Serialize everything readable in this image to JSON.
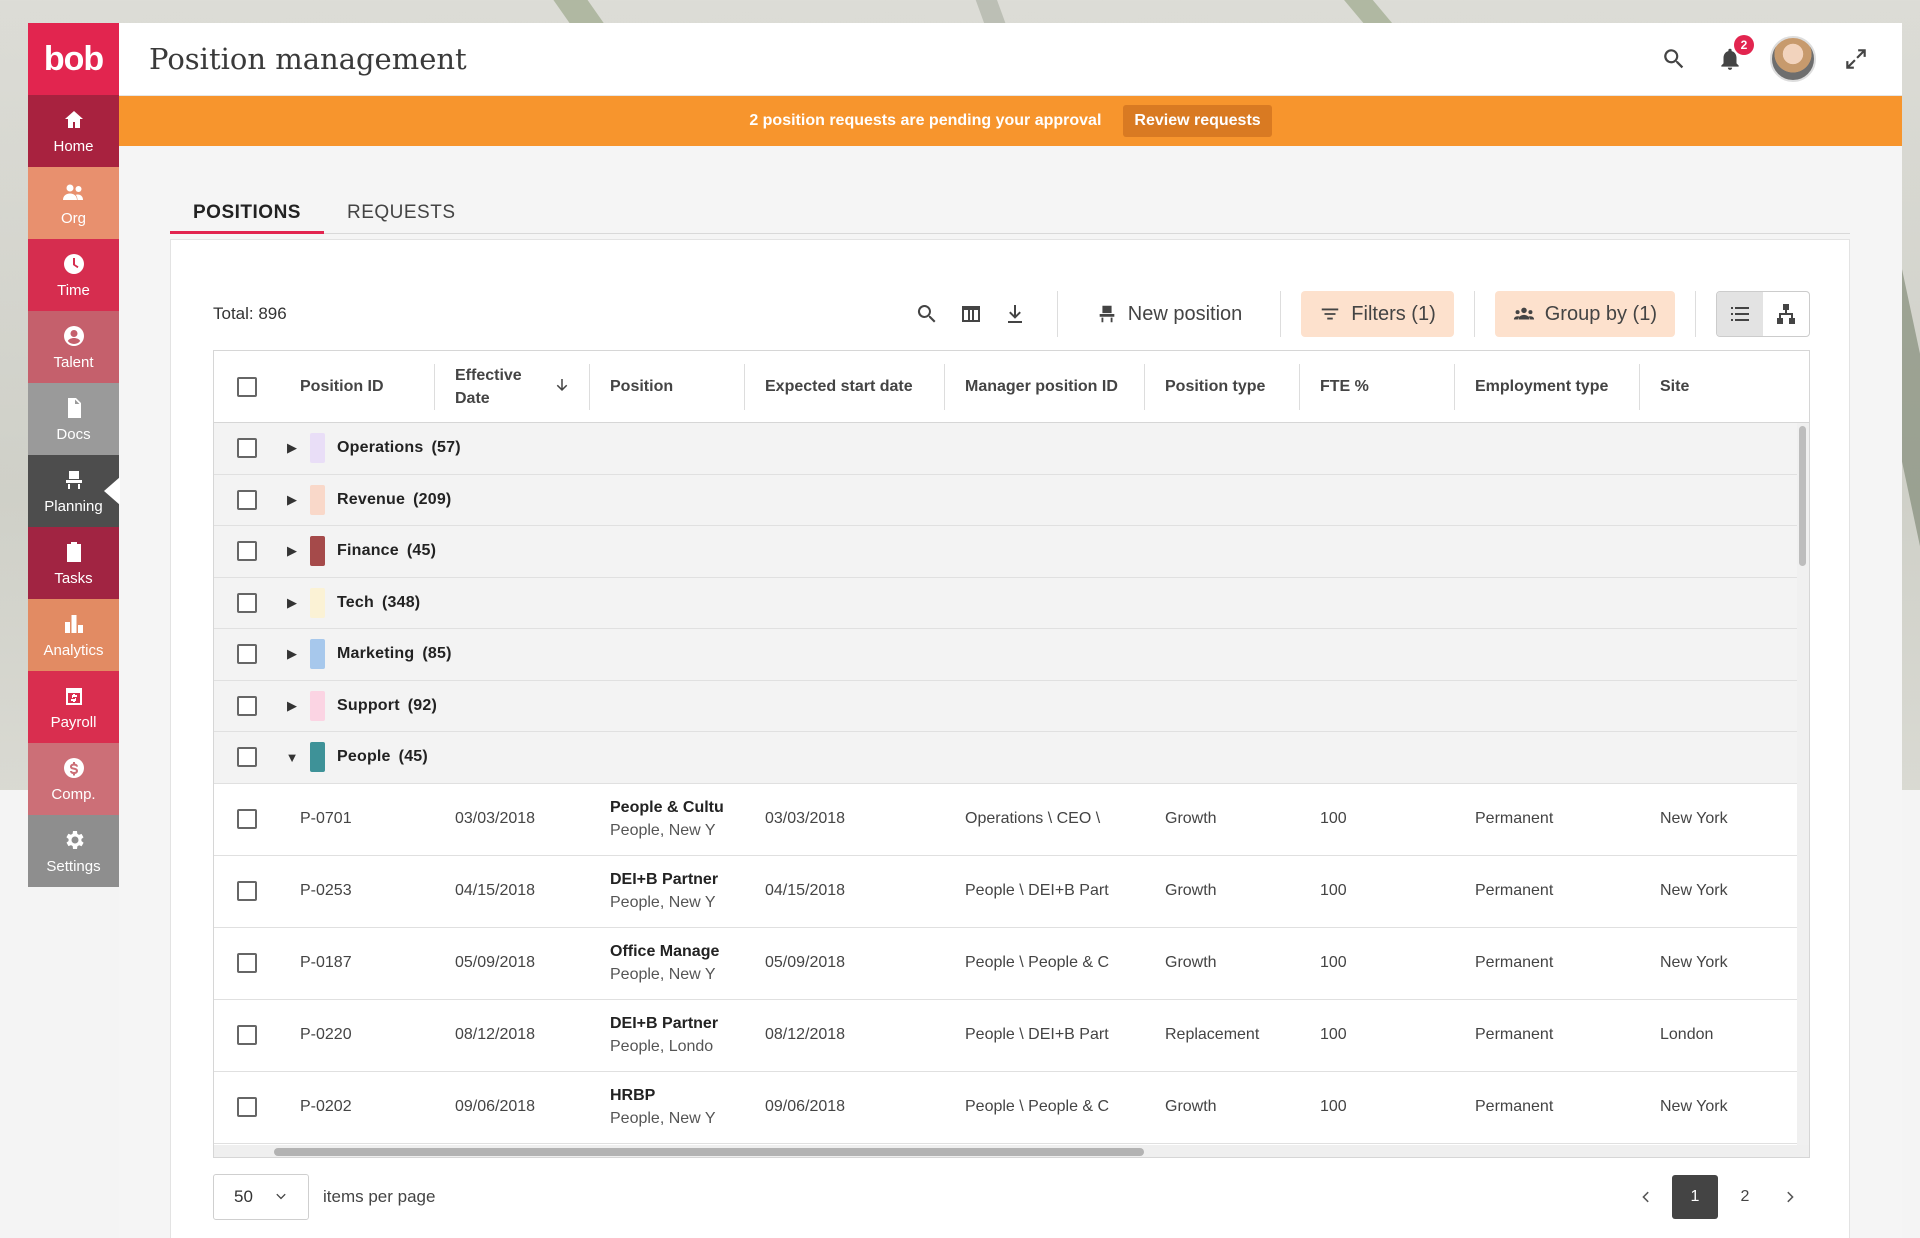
{
  "app": {
    "logo": "bob"
  },
  "sidebar": {
    "items": [
      {
        "label": "Home",
        "icon": "home-icon",
        "color": "#a8223f"
      },
      {
        "label": "Org",
        "icon": "org-icon",
        "color": "#e8906e"
      },
      {
        "label": "Time",
        "icon": "clock-icon",
        "color": "#d62d4f"
      },
      {
        "label": "Talent",
        "icon": "talent-icon",
        "color": "#c5606c"
      },
      {
        "label": "Docs",
        "icon": "document-icon",
        "color": "#9a9a9a"
      },
      {
        "label": "Planning",
        "icon": "planning-icon",
        "color": "#4d4d4d",
        "active": true
      },
      {
        "label": "Tasks",
        "icon": "tasks-icon",
        "color": "#a12442"
      },
      {
        "label": "Analytics",
        "icon": "analytics-icon",
        "color": "#e28b63"
      },
      {
        "label": "Payroll",
        "icon": "payroll-icon",
        "color": "#d92e4f"
      },
      {
        "label": "Comp.",
        "icon": "compensation-icon",
        "color": "#cc6f77"
      },
      {
        "label": "Settings",
        "icon": "gear-icon",
        "color": "#8e8e8e"
      }
    ]
  },
  "header": {
    "title": "Position management",
    "notification_count": "2"
  },
  "banner": {
    "message": "2 position requests are pending your approval",
    "button": "Review requests"
  },
  "tabs": [
    "POSITIONS",
    "REQUESTS"
  ],
  "toolbar": {
    "total": "Total: 896",
    "new_position": "New position",
    "filters": "Filters (1)",
    "group_by": "Group by (1)"
  },
  "table": {
    "columns": [
      {
        "label": "Position ID"
      },
      {
        "label": "Effective Date"
      },
      {
        "label": "Position"
      },
      {
        "label": "Expected start date"
      },
      {
        "label": "Manager position ID"
      },
      {
        "label": "Position type"
      },
      {
        "label": "FTE %"
      },
      {
        "label": "Employment type"
      },
      {
        "label": "Site"
      }
    ],
    "groups": [
      {
        "name": "Operations",
        "count": "(57)",
        "color": "#e9def7",
        "expanded": false
      },
      {
        "name": "Revenue",
        "count": "(209)",
        "color": "#f9d8c9",
        "expanded": false
      },
      {
        "name": "Finance",
        "count": "(45)",
        "color": "#a54a4a",
        "expanded": false
      },
      {
        "name": "Tech",
        "count": "(348)",
        "color": "#fbf2d5",
        "expanded": false
      },
      {
        "name": "Marketing",
        "count": "(85)",
        "color": "#a7c8ec",
        "expanded": false
      },
      {
        "name": "Support",
        "count": "(92)",
        "color": "#fbd4e3",
        "expanded": false
      },
      {
        "name": "People",
        "count": "(45)",
        "color": "#3e9298",
        "expanded": true
      }
    ],
    "rows": [
      {
        "id": "P-0701",
        "effective": "03/03/2018",
        "position": "People & Cultu",
        "position_sub": "People, New Y",
        "start": "03/03/2018",
        "manager": "Operations \\ CEO \\",
        "type": "Growth",
        "fte": "100",
        "employment": "Permanent",
        "site": "New York"
      },
      {
        "id": "P-0253",
        "effective": "04/15/2018",
        "position": "DEI+B Partner",
        "position_sub": "People, New Y",
        "start": "04/15/2018",
        "manager": "People \\ DEI+B Part",
        "type": "Growth",
        "fte": "100",
        "employment": "Permanent",
        "site": "New York"
      },
      {
        "id": "P-0187",
        "effective": "05/09/2018",
        "position": "Office Manage",
        "position_sub": "People, New Y",
        "start": "05/09/2018",
        "manager": "People \\ People & C",
        "type": "Growth",
        "fte": "100",
        "employment": "Permanent",
        "site": "New York"
      },
      {
        "id": "P-0220",
        "effective": "08/12/2018",
        "position": "DEI+B Partner",
        "position_sub": "People, Londo",
        "start": "08/12/2018",
        "manager": "People \\ DEI+B Part",
        "type": "Replacement",
        "fte": "100",
        "employment": "Permanent",
        "site": "London"
      },
      {
        "id": "P-0202",
        "effective": "09/06/2018",
        "position": "HRBP",
        "position_sub": "People, New Y",
        "start": "09/06/2018",
        "manager": "People \\ People & C",
        "type": "Growth",
        "fte": "100",
        "employment": "Permanent",
        "site": "New York"
      }
    ]
  },
  "pagination": {
    "per_page": "50",
    "per_page_label": "items per page",
    "pages": [
      "1",
      "2"
    ],
    "current": "1"
  }
}
